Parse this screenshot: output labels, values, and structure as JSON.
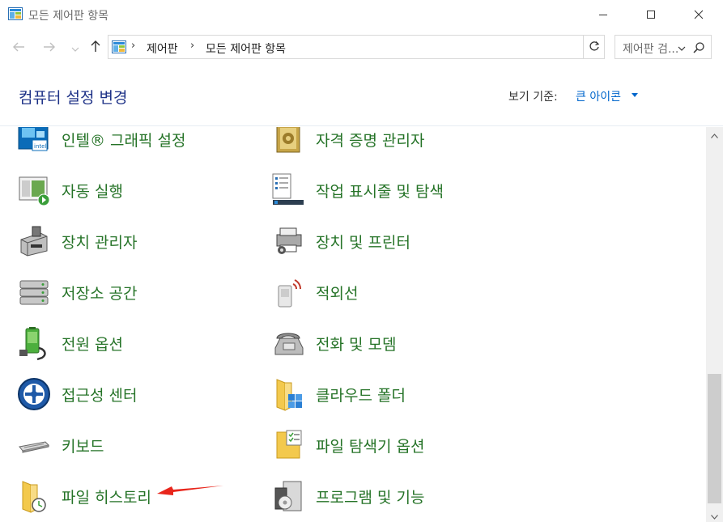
{
  "window": {
    "title": "모든 제어판 항목",
    "icons": {
      "app": "control-panel-icon",
      "minimize": "minimize-icon",
      "maximize": "maximize-icon",
      "close": "close-icon"
    }
  },
  "nav": {
    "breadcrumb": [
      "제어판",
      "모든 제어판 항목"
    ],
    "icons": {
      "back": "arrow-left-icon",
      "forward": "arrow-right-icon",
      "recent": "chevron-down-icon",
      "up": "arrow-up-icon",
      "refresh": "refresh-icon"
    }
  },
  "search": {
    "placeholder": "제어판 검..."
  },
  "header": {
    "title": "컴퓨터 설정 변경",
    "view_by_label": "보기 기준:",
    "view_by_value": "큰 아이콘"
  },
  "items": {
    "left": [
      {
        "label": "인텔® 그래픽 설정",
        "icon": "intel-graphics-icon"
      },
      {
        "label": "자동 실행",
        "icon": "autoplay-icon"
      },
      {
        "label": "장치 관리자",
        "icon": "device-manager-icon"
      },
      {
        "label": "저장소 공간",
        "icon": "storage-spaces-icon"
      },
      {
        "label": "전원 옵션",
        "icon": "power-options-icon"
      },
      {
        "label": "접근성 센터",
        "icon": "ease-of-access-icon"
      },
      {
        "label": "키보드",
        "icon": "keyboard-icon"
      },
      {
        "label": "파일 히스토리",
        "icon": "file-history-icon"
      }
    ],
    "right": [
      {
        "label": "자격 증명 관리자",
        "icon": "credential-manager-icon"
      },
      {
        "label": "작업 표시줄 및 탐색",
        "icon": "taskbar-icon"
      },
      {
        "label": "장치 및 프린터",
        "icon": "devices-printers-icon"
      },
      {
        "label": "적외선",
        "icon": "infrared-icon"
      },
      {
        "label": "전화 및 모뎀",
        "icon": "phone-modem-icon"
      },
      {
        "label": "클라우드 폴더",
        "icon": "work-folders-icon"
      },
      {
        "label": "파일 탐색기 옵션",
        "icon": "file-explorer-options-icon"
      },
      {
        "label": "프로그램 및 기능",
        "icon": "programs-features-icon"
      }
    ]
  },
  "colors": {
    "header_title": "#1e3287",
    "item_label": "#257327",
    "link": "#0066cc",
    "annotation": "#e8261c"
  }
}
